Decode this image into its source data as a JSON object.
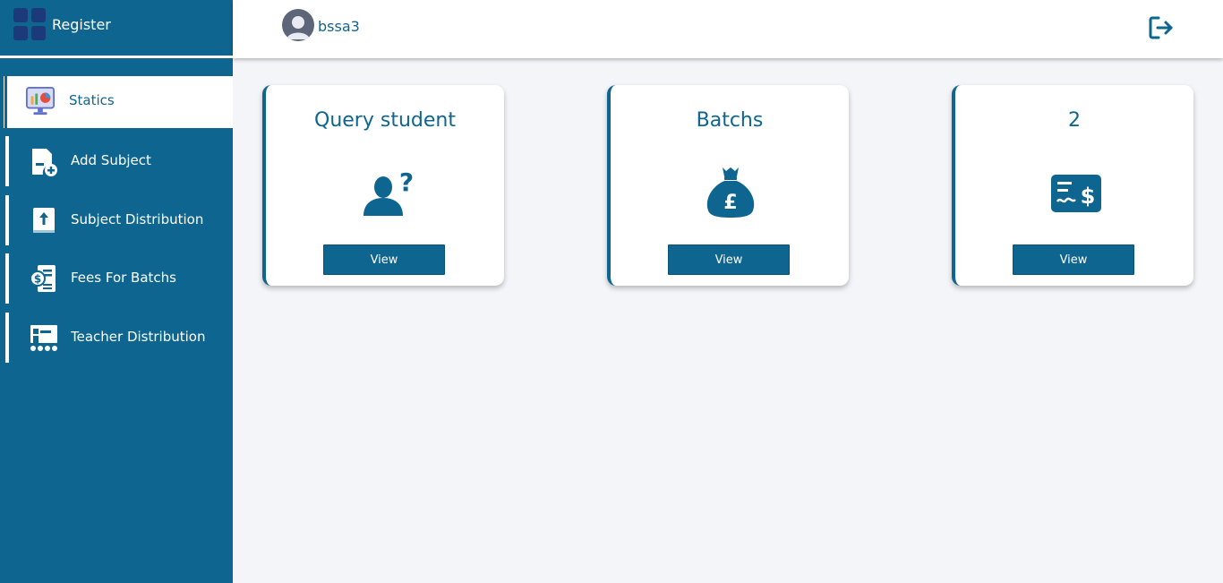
{
  "brand": {
    "title": "Register"
  },
  "sidebar": {
    "items": [
      {
        "label": "Statics",
        "icon": "statistics-monitor-icon",
        "active": true
      },
      {
        "label": "Add Subject",
        "icon": "add-document-icon",
        "active": false
      },
      {
        "label": "Subject Distribution",
        "icon": "upload-document-icon",
        "active": false
      },
      {
        "label": "Fees For Batchs",
        "icon": "fees-invoice-icon",
        "active": false
      },
      {
        "label": "Teacher Distribution",
        "icon": "teacher-board-icon",
        "active": false
      }
    ]
  },
  "header": {
    "username": "bssa3",
    "logout_icon": "logout-icon"
  },
  "cards": [
    {
      "title": "Query student",
      "icon": "person-question-icon",
      "button": "View"
    },
    {
      "title": "Batchs",
      "icon": "money-bag-pound-icon",
      "button": "View"
    },
    {
      "title": "2",
      "icon": "check-dollar-icon",
      "button": "View"
    }
  ],
  "colors": {
    "primary": "#0e6690",
    "background": "#f4f5f9",
    "sidebar": "#0e6690"
  }
}
